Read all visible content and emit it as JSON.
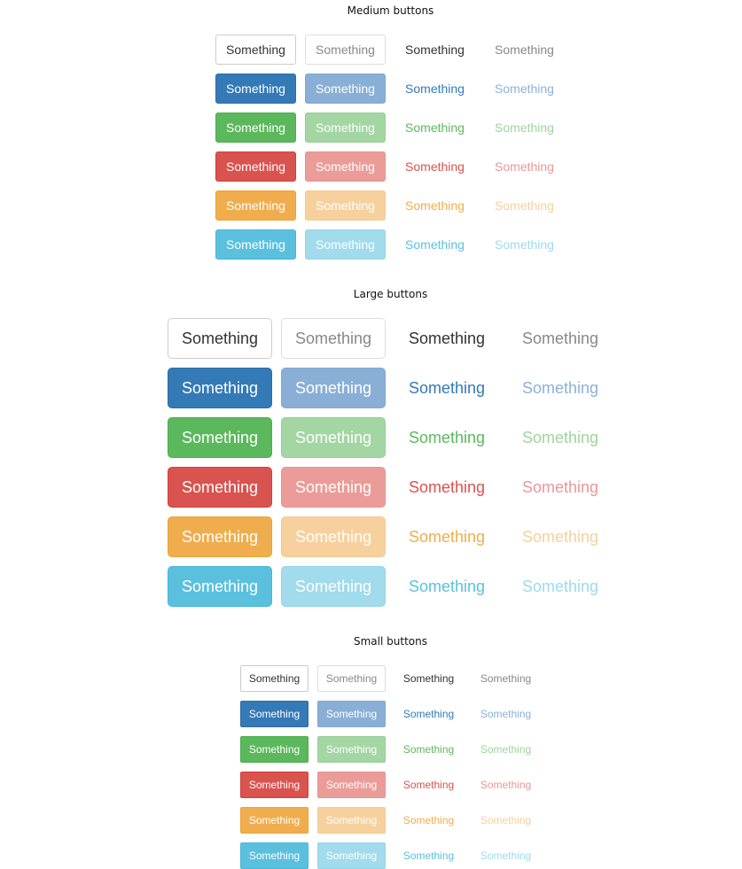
{
  "sections": {
    "medium": {
      "title": "Medium buttons"
    },
    "large": {
      "title": "Large buttons"
    },
    "small": {
      "title": "Small buttons"
    }
  },
  "variants": [
    "default",
    "primary",
    "success",
    "danger",
    "warning",
    "info"
  ],
  "button_styles": [
    "solid",
    "faded",
    "link",
    "faded-link"
  ],
  "button_label": "Something",
  "colors": {
    "default": "#333333",
    "primary": "#337ab7",
    "success": "#5cb85c",
    "danger": "#d9534f",
    "warning": "#f0ad4e",
    "info": "#5bc0de"
  }
}
